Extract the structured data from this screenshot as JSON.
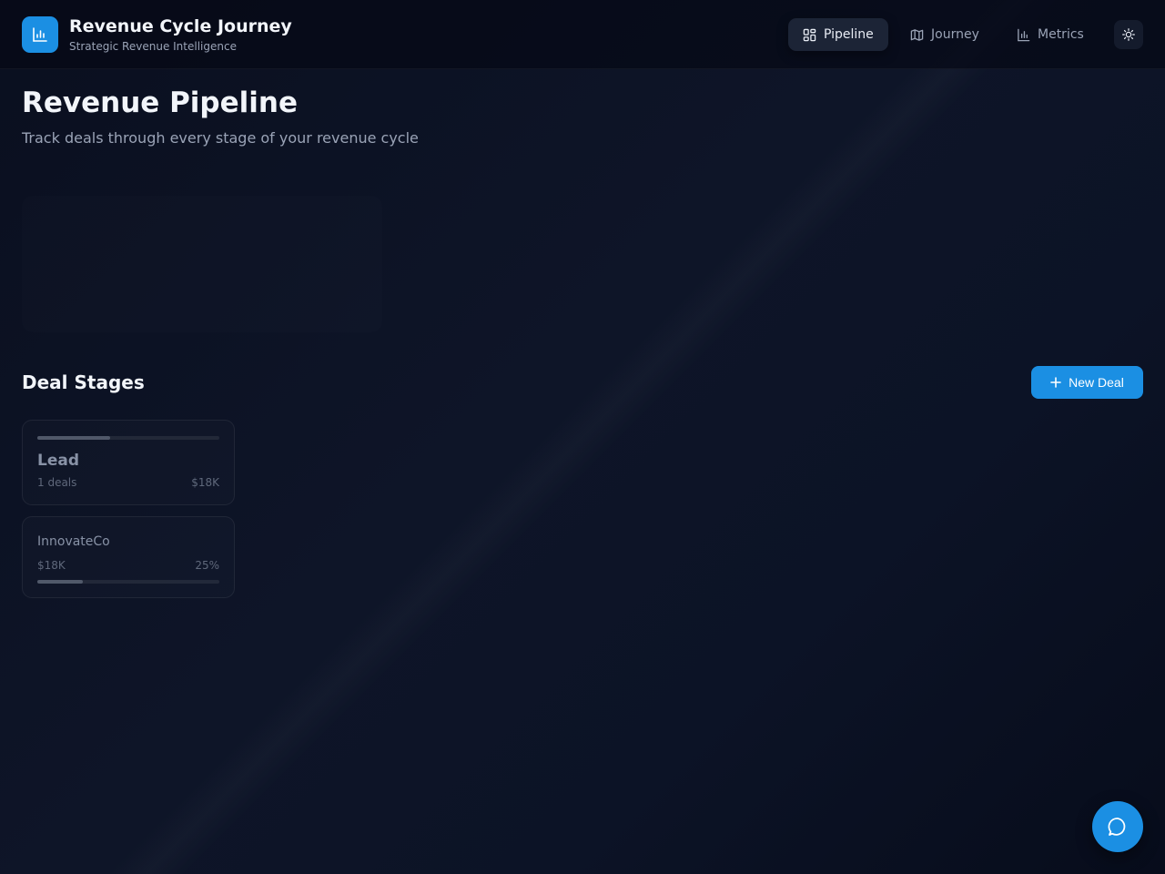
{
  "app": {
    "title": "Revenue Cycle Journey",
    "subtitle": "Strategic Revenue Intelligence",
    "logo_icon": "bar-chart-icon",
    "accent_color": "#1b8fe3"
  },
  "nav": {
    "items": [
      {
        "label": "Pipeline",
        "icon": "grid-icon",
        "active": true
      },
      {
        "label": "Journey",
        "icon": "map-icon",
        "active": false
      },
      {
        "label": "Metrics",
        "icon": "bar-chart-icon",
        "active": false
      }
    ],
    "theme_toggle_icon": "sun-icon"
  },
  "main": {
    "title": "Revenue Pipeline",
    "subtitle": "Track deals through every stage of your revenue cycle"
  },
  "deal_stages": {
    "title": "Deal Stages",
    "new_deal_label": "New Deal",
    "new_deal_icon": "plus-icon",
    "stages": [
      {
        "name": "Lead",
        "deals_text": "1 deals",
        "value": "$18K",
        "progress": 0.4
      }
    ],
    "deals": [
      {
        "name": "InnovateCo",
        "value": "$18K",
        "probability": "25%",
        "progress": 0.25
      }
    ]
  },
  "chat": {
    "icon": "chat-bubble-icon"
  }
}
